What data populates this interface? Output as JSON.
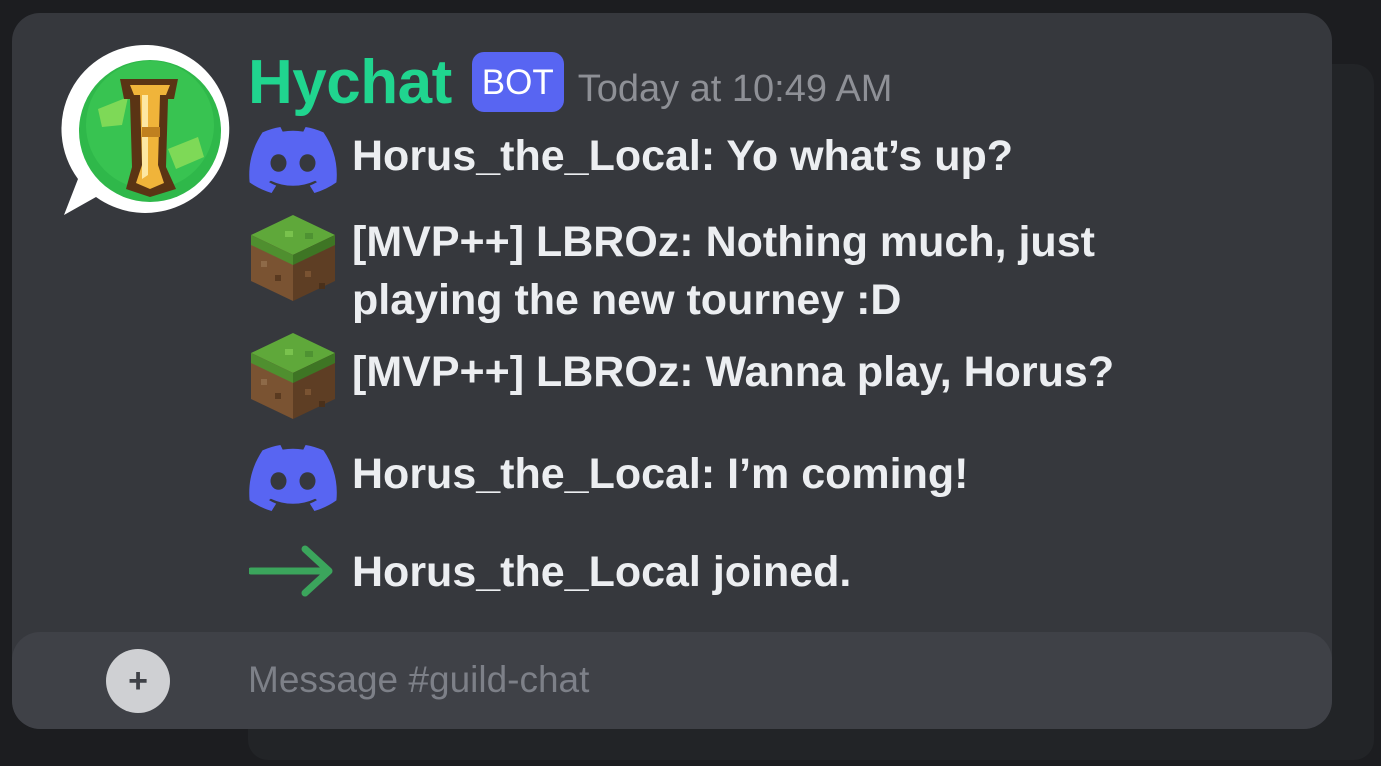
{
  "message": {
    "author": "Hychat",
    "badge": "BOT",
    "timestamp": "Today at 10:49 AM",
    "author_color": "#20d58f",
    "lines": [
      {
        "icon": "discord-icon",
        "text": "Horus_the_Local: Yo what’s up?"
      },
      {
        "icon": "minecraft-grass-block-icon",
        "text": "[MVP++] LBROz: Nothing much, just playing the new tourney :D"
      },
      {
        "icon": "minecraft-grass-block-icon",
        "text": "[MVP++] LBROz: Wanna play, Horus?"
      },
      {
        "icon": "discord-icon",
        "text": "Horus_the_Local: I’m coming!"
      },
      {
        "icon": "join-arrow-icon",
        "text": "Horus_the_Local joined."
      }
    ]
  },
  "composer": {
    "add_label": "+",
    "placeholder": "Message #guild-chat",
    "value": ""
  },
  "colors": {
    "discord_blurple": "#5865f2",
    "join_arrow": "#3ba55c"
  }
}
